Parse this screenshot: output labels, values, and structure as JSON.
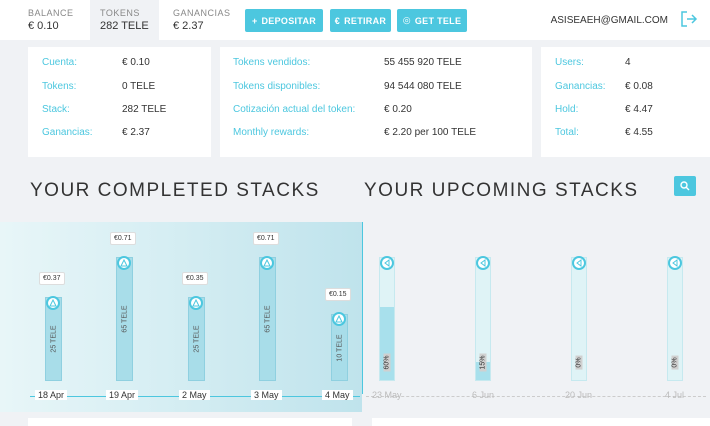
{
  "header": {
    "balance": {
      "label": "BALANCE",
      "value": "€ 0.10"
    },
    "tokens": {
      "label": "TOKENS",
      "value": "282 TELE"
    },
    "ganancias": {
      "label": "GANANCIAS",
      "value": "€ 2.37"
    },
    "buttons": {
      "depositar": "DEPOSITAR",
      "retirar": "RETIRAR",
      "get_tele": "GET TELE"
    },
    "email": "ASISEAEH@GMAIL.COM"
  },
  "card_account": [
    {
      "key": "Cuenta:",
      "value": "€ 0.10"
    },
    {
      "key": "Tokens:",
      "value": "0 TELE"
    },
    {
      "key": "Stack:",
      "value": "282 TELE"
    },
    {
      "key": "Ganancias:",
      "value": "€ 2.37"
    }
  ],
  "card_tokens": [
    {
      "key": "Tokens vendidos:",
      "value": "55 455 920 TELE"
    },
    {
      "key": "Tokens disponibles:",
      "value": "94 544 080 TELE"
    },
    {
      "key": "Cotización actual del token:",
      "value": "€ 0.20"
    },
    {
      "key": "Monthly rewards:",
      "value": "€ 2.20 per 100 TELE"
    }
  ],
  "card_users": [
    {
      "key": "Users:",
      "value": "4"
    },
    {
      "key": "Ganancias:",
      "value": "€ 0.08"
    },
    {
      "key": "Hold:",
      "value": "€ 4.47"
    },
    {
      "key": "Total:",
      "value": "€ 4.55"
    }
  ],
  "sections": {
    "completed": "YOUR COMPLETED STACKS",
    "upcoming": "YOUR UPCOMING STACKS"
  },
  "chart_data": {
    "type": "bar",
    "completed": [
      {
        "date": "18 Apr",
        "reward": "€0.37",
        "tokens": "25 TELE"
      },
      {
        "date": "19 Apr",
        "reward": "€0.71",
        "tokens": "65 TELE"
      },
      {
        "date": "2 May",
        "reward": "€0.35",
        "tokens": "25 TELE"
      },
      {
        "date": "3 May",
        "reward": "€0.71",
        "tokens": "65 TELE"
      },
      {
        "date": "4 May",
        "reward": "€0.15",
        "tokens": "10 TELE"
      }
    ],
    "upcoming": [
      {
        "date": "23 May",
        "progress": "60%",
        "fraction": 0.6
      },
      {
        "date": "6 Jun",
        "progress": "15%",
        "fraction": 0.15
      },
      {
        "date": "20 Jun",
        "progress": "0%",
        "fraction": 0
      },
      {
        "date": "4 Jul",
        "progress": "0%",
        "fraction": 0
      }
    ]
  },
  "colors": {
    "accent": "#4cc7df",
    "bar": "#a8dde9"
  }
}
